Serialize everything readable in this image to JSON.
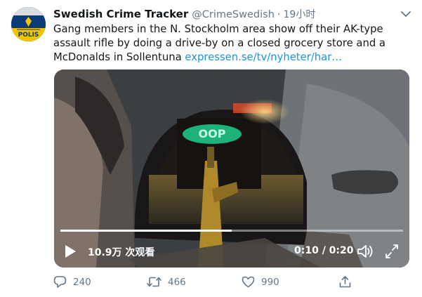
{
  "tweet": {
    "author_name": "Swedish Crime Tracker",
    "author_handle": "@CrimeSwedish",
    "separator": "·",
    "timestamp": "19小时",
    "text": "Gang members in the N. Stockholm area show off their AK-type assault rifle by doing a drive-by on a closed grocery store and a McDonalds in Sollentuna ",
    "link_text": "expressen.se/tv/nyheter/har…",
    "avatar_text": "POLIS",
    "avatar_icon": "police-badge-avatar"
  },
  "video": {
    "progress": 0.5,
    "views": "10.9万 次观看",
    "duration": "0:10 / 0:20",
    "scene_sign": "OOP",
    "icons": {
      "play": "play-icon",
      "volume": "volume-icon",
      "fullscreen": "fullscreen-icon"
    }
  },
  "actions": {
    "reply_count": "240",
    "retweet_count": "466",
    "like_count": "990",
    "icons": [
      "reply-icon",
      "retweet-icon",
      "like-icon",
      "share-icon"
    ]
  },
  "colors": {
    "link": "#1b95e0",
    "muted": "#657786",
    "text": "#14171a"
  }
}
